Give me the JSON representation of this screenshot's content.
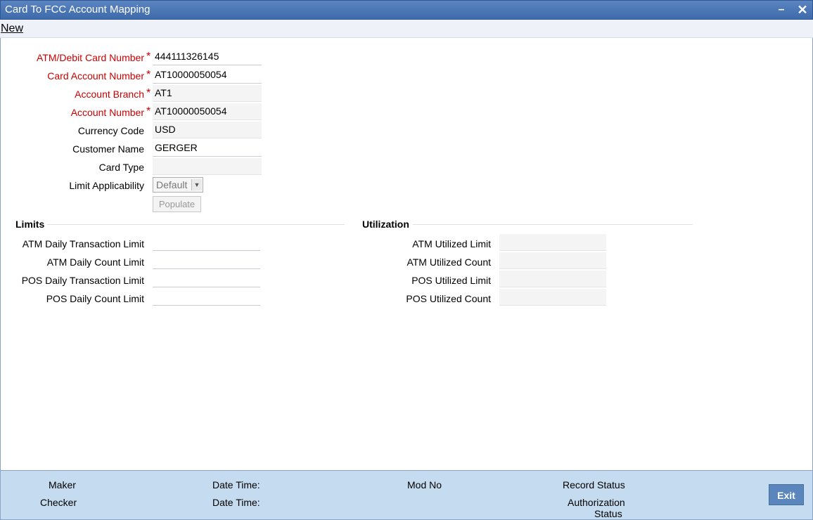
{
  "window": {
    "title": "Card To FCC Account Mapping"
  },
  "menu": {
    "new_label": "New"
  },
  "form": {
    "atm_card_number": {
      "label": "ATM/Debit Card Number",
      "value": "444111326145"
    },
    "card_account_number": {
      "label": "Card Account Number",
      "value": "AT10000050054"
    },
    "account_branch": {
      "label": "Account Branch",
      "value": "AT1"
    },
    "account_number": {
      "label": "Account Number",
      "value": "AT10000050054"
    },
    "currency_code": {
      "label": "Currency Code",
      "value": "USD"
    },
    "customer_name": {
      "label": "Customer Name",
      "value": "GERGER"
    },
    "card_type": {
      "label": "Card Type",
      "value": ""
    },
    "limit_applicability": {
      "label": "Limit Applicability",
      "value": "Default"
    },
    "populate_label": "Populate",
    "required_mark": "*"
  },
  "limits": {
    "heading": "Limits",
    "atm_daily_txn": {
      "label": "ATM Daily Transaction Limit",
      "value": ""
    },
    "atm_daily_count": {
      "label": "ATM Daily Count Limit",
      "value": ""
    },
    "pos_daily_txn": {
      "label": "POS Daily Transaction Limit",
      "value": ""
    },
    "pos_daily_count": {
      "label": "POS Daily Count Limit",
      "value": ""
    }
  },
  "utilization": {
    "heading": "Utilization",
    "atm_util_limit": {
      "label": "ATM Utilized Limit",
      "value": ""
    },
    "atm_util_count": {
      "label": "ATM Utilized Count",
      "value": ""
    },
    "pos_util_limit": {
      "label": "POS Utilized Limit",
      "value": ""
    },
    "pos_util_count": {
      "label": "POS Utilized Count",
      "value": ""
    }
  },
  "footer": {
    "maker": "Maker",
    "checker": "Checker",
    "date_time_1": "Date Time:",
    "date_time_2": "Date Time:",
    "mod_no": "Mod No",
    "record_status": "Record Status",
    "auth_status_line1": "Authorization",
    "auth_status_line2": "Status",
    "exit_label": "Exit"
  }
}
